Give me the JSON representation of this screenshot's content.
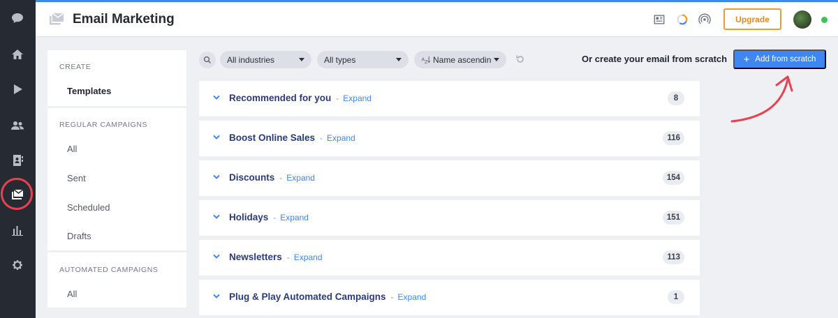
{
  "header": {
    "title": "Email Marketing",
    "upgrade_label": "Upgrade"
  },
  "rail": {
    "icons": [
      "chat-icon",
      "home-icon",
      "play-icon",
      "users-icon",
      "contacts-book-icon",
      "email-campaign-icon",
      "bar-chart-icon",
      "settings-icon"
    ],
    "active": "email-campaign-icon",
    "highlight_color": "#e8414f"
  },
  "sidenav": {
    "create_section": "CREATE",
    "templates": "Templates",
    "regular_section": "REGULAR CAMPAIGNS",
    "regular_items": [
      "All",
      "Sent",
      "Scheduled",
      "Drafts"
    ],
    "automated_section": "AUTOMATED CAMPAIGNS",
    "automated_items": [
      "All"
    ]
  },
  "filters": {
    "industry": "All industries",
    "type": "All types",
    "sort": "Name ascending"
  },
  "scratch": {
    "prompt": "Or create your email from scratch",
    "button_label": "Add from scratch"
  },
  "categories": [
    {
      "name": "Recommended for you",
      "expand": "Expand",
      "count": "8"
    },
    {
      "name": "Boost Online Sales",
      "expand": "Expand",
      "count": "116"
    },
    {
      "name": "Discounts",
      "expand": "Expand",
      "count": "154"
    },
    {
      "name": "Holidays",
      "expand": "Expand",
      "count": "151"
    },
    {
      "name": "Newsletters",
      "expand": "Expand",
      "count": "113"
    },
    {
      "name": "Plug & Play Automated Campaigns",
      "expand": "Expand",
      "count": "1"
    }
  ],
  "colors": {
    "accent": "#3f86f0",
    "upgrade": "#f19a2c",
    "annotation": "#e8414f",
    "online": "#3ec44d"
  }
}
